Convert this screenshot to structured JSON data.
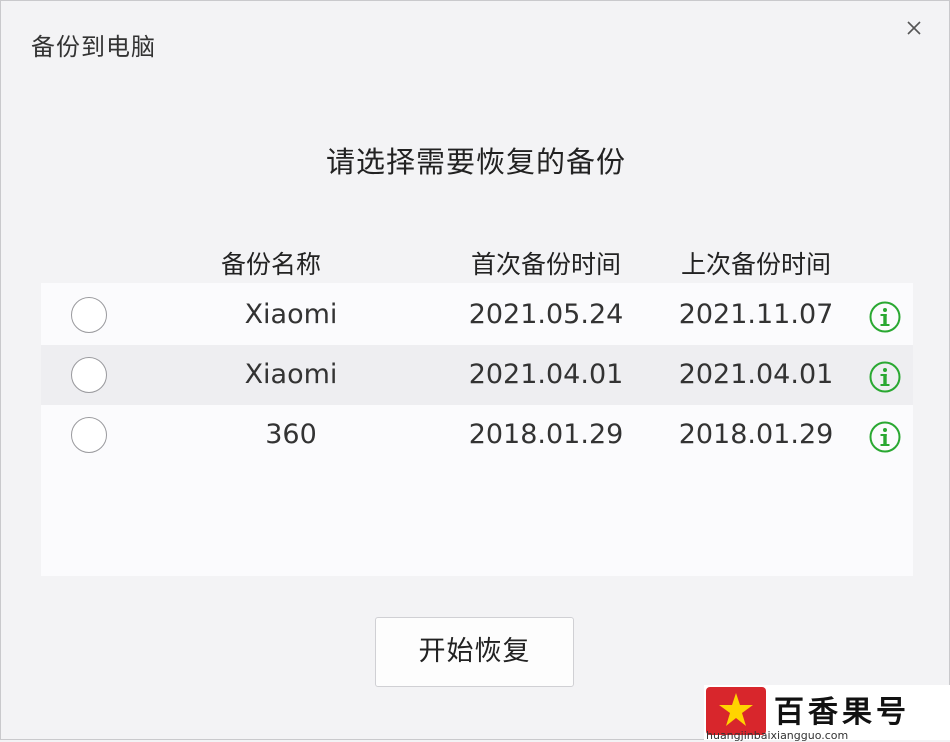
{
  "window": {
    "title": "备份到电脑",
    "close_icon": "close-icon"
  },
  "heading": "请选择需要恢复的备份",
  "columns": {
    "name": "备份名称",
    "first_backup": "首次备份时间",
    "last_backup": "上次备份时间"
  },
  "rows": [
    {
      "name": "Xiaomi",
      "first": "2021.05.24",
      "last": "2021.11.07",
      "selected": false,
      "info_icon": "info-icon"
    },
    {
      "name": "Xiaomi",
      "first": "2021.04.01",
      "last": "2021.04.01",
      "selected": false,
      "info_icon": "info-icon"
    },
    {
      "name": "360",
      "first": "2018.01.29",
      "last": "2018.01.29",
      "selected": false,
      "info_icon": "info-icon"
    }
  ],
  "actions": {
    "start_restore": "开始恢复"
  },
  "watermark": {
    "name": "百香果号",
    "url": "huangjinbaixiangguo.com"
  },
  "colors": {
    "info_green": "#2aa832",
    "background": "#f3f3f5",
    "list_background": "#fbfbfd",
    "row_alt": "#eeeef1",
    "watermark_red": "#d8262c"
  }
}
